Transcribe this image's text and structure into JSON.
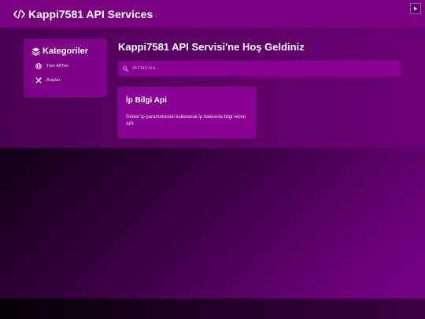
{
  "header": {
    "title": "Kappi7581 API Services",
    "brand_icon": "code-icon",
    "media_button_icon": "play-icon"
  },
  "sidebar": {
    "title": "Kategoriler",
    "title_icon": "layers-icon",
    "items": [
      {
        "label": "Tüm API'ler",
        "icon": "globe-icon"
      },
      {
        "label": "Araçlar",
        "icon": "tools-icon"
      }
    ]
  },
  "main": {
    "welcome": "Kappi7581 API Servisi'ne Hoş Geldiniz",
    "search": {
      "placeholder": "API'leri Ara...",
      "value": "",
      "icon": "search-icon"
    },
    "cards": [
      {
        "title": "İp Bilgi Api",
        "description": "Girilen ip parametresini kullanarak ip hakkında bilgi veren API"
      }
    ]
  },
  "colors": {
    "header_bg": "#7a0080",
    "card_bg": "#8b0094",
    "sidebar_bg": "#7e0086",
    "text": "#ffffff"
  }
}
